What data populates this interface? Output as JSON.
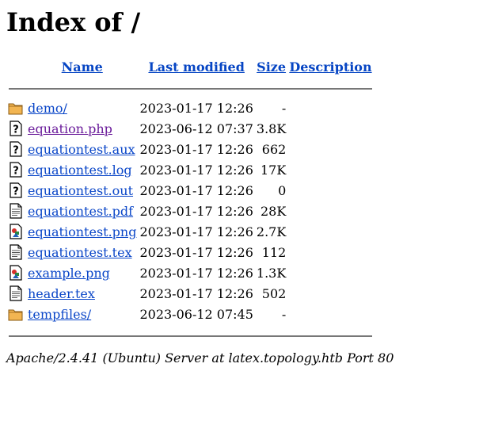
{
  "title": "Index of /",
  "headers": {
    "name": "Name",
    "last_modified": "Last modified",
    "size": "Size",
    "description": "Description"
  },
  "rows": [
    {
      "name": "demo/",
      "date": "2023-01-17 12:26",
      "size": "-",
      "icon": "folder-icon",
      "visited": false
    },
    {
      "name": "equation.php",
      "date": "2023-06-12 07:37",
      "size": "3.8K",
      "icon": "unknown-file-icon",
      "visited": true
    },
    {
      "name": "equationtest.aux",
      "date": "2023-01-17 12:26",
      "size": "662",
      "icon": "unknown-file-icon",
      "visited": false
    },
    {
      "name": "equationtest.log",
      "date": "2023-01-17 12:26",
      "size": "17K",
      "icon": "unknown-file-icon",
      "visited": false
    },
    {
      "name": "equationtest.out",
      "date": "2023-01-17 12:26",
      "size": "0",
      "icon": "unknown-file-icon",
      "visited": false
    },
    {
      "name": "equationtest.pdf",
      "date": "2023-01-17 12:26",
      "size": "28K",
      "icon": "text-file-icon",
      "visited": false
    },
    {
      "name": "equationtest.png",
      "date": "2023-01-17 12:26",
      "size": "2.7K",
      "icon": "image-file-icon",
      "visited": false
    },
    {
      "name": "equationtest.tex",
      "date": "2023-01-17 12:26",
      "size": "112",
      "icon": "text-file-icon",
      "visited": false
    },
    {
      "name": "example.png",
      "date": "2023-01-17 12:26",
      "size": "1.3K",
      "icon": "image-file-icon",
      "visited": false
    },
    {
      "name": "header.tex",
      "date": "2023-01-17 12:26",
      "size": "502",
      "icon": "text-file-icon",
      "visited": false
    },
    {
      "name": "tempfiles/",
      "date": "2023-06-12 07:45",
      "size": "-",
      "icon": "folder-icon",
      "visited": false
    }
  ],
  "footer": "Apache/2.4.41 (Ubuntu) Server at latex.topology.htb Port 80",
  "colors": {
    "link": "#0a46c8",
    "visited_link": "#6a1b9a",
    "folder": "#e8a33d"
  }
}
